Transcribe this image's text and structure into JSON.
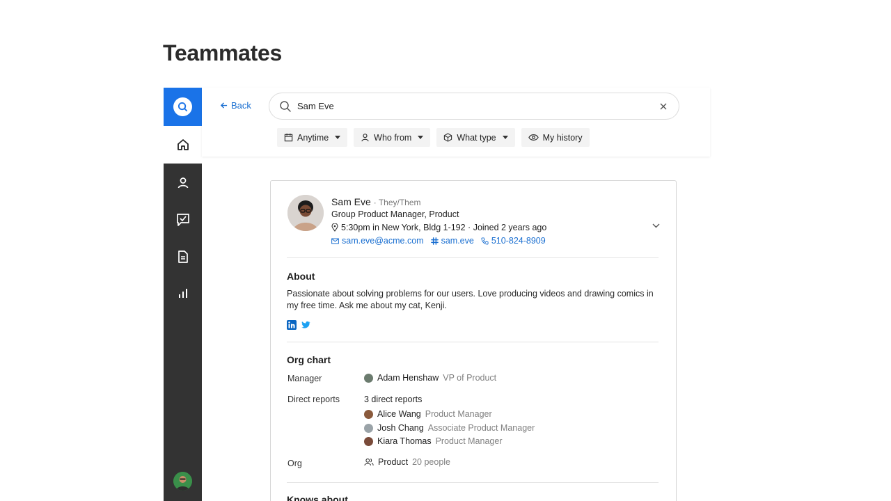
{
  "page": {
    "title": "Teammates"
  },
  "search": {
    "back_label": "Back",
    "query": "Sam Eve",
    "filters": [
      {
        "label": "Anytime",
        "icon": "calendar-icon"
      },
      {
        "label": "Who from",
        "icon": "person-icon"
      },
      {
        "label": "What type",
        "icon": "cube-icon"
      },
      {
        "label": "My history",
        "icon": "eye-icon"
      }
    ]
  },
  "sidebar": {
    "items": [
      "search-icon",
      "home-icon",
      "person-icon",
      "tasks-icon",
      "document-icon",
      "chart-icon"
    ]
  },
  "profile": {
    "name": "Sam Eve",
    "pronouns": "· They/Them",
    "role": "Group Product Manager, Product",
    "location": "5:30pm in New York, Bldg 1-192 · Joined 2 years ago",
    "email": "sam.eve@acme.com",
    "slack": "sam.eve",
    "phone": "510-824-8909"
  },
  "about": {
    "title": "About",
    "text": "Passionate about solving problems for our users. Love producing videos and drawing comics in my free time. Ask me about my cat, Kenji."
  },
  "org": {
    "title": "Org chart",
    "manager_label": "Manager",
    "manager_name": "Adam Henshaw",
    "manager_title": "VP of Product",
    "reports_label": "Direct reports",
    "reports_count": "3 direct reports",
    "reports": [
      {
        "name": "Alice Wang",
        "title": "Product Manager"
      },
      {
        "name": "Josh Chang",
        "title": "Associate Product Manager"
      },
      {
        "name": "Kiara Thomas",
        "title": "Product Manager"
      }
    ],
    "org_label": "Org",
    "org_name": "Product",
    "org_size": "20 people"
  },
  "knows_about": {
    "title": "Knows about"
  },
  "colors": {
    "accent": "#1a73e8",
    "sidebar": "#333333",
    "link": "#1a6fd1"
  }
}
